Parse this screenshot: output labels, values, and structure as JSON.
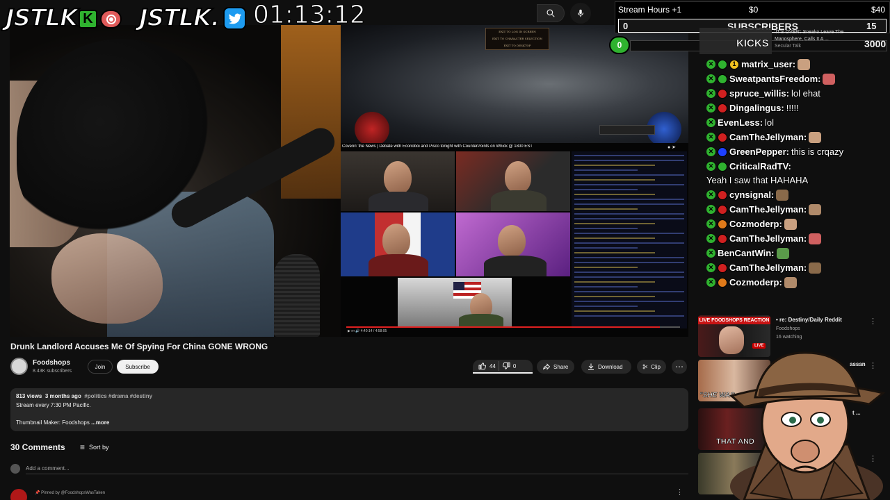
{
  "overlay": {
    "brand_1": "JSTLK",
    "brand_2": "JSTLK.",
    "kick_letter": "K",
    "timer": "01:13:12",
    "goals": {
      "label": "Stream Hours +1",
      "amount_start": "$0",
      "amount_end": "$40",
      "subs_current": "0",
      "subs_label": "SUBSCRIBERS",
      "subs_target": "15",
      "kicks_current": "0",
      "kicks_label": "KICKS",
      "kicks_target": "3000"
    },
    "kicks_news": {
      "title": "'IT'S OVER': Sneako Leave The Manosphere, Calls It A ...",
      "channel": "Secular Talk"
    }
  },
  "player": {
    "game_menu": [
      "EXIT TO LOG IN SCREEN",
      "EXIT TO CHARACTER SELECTION",
      "EXIT TO DESKTOP"
    ],
    "debate_title": "Coverin' the News | Debate with Econoboi and Pisco tonight with CounterPoints on Whick @ 1800 EST",
    "time": "4:40:14 / 4:58:05",
    "progress": 0.94
  },
  "video": {
    "title": "Drunk Landlord Accuses Me Of Spying For China GONE WRONG",
    "channel": "Foodshops",
    "subscribers": "8.43K subscribers",
    "join": "Join",
    "subscribe": "Subscribe",
    "likes": "44",
    "dislikes": "0",
    "share": "Share",
    "download": "Download",
    "clip": "Clip"
  },
  "description": {
    "views": "813 views",
    "date": "3 months ago",
    "tags": "#politics #drama #destiny",
    "line1": "Stream every 7:30 PM Pacific.",
    "line2": "Thumbnail Maker: Foodshops",
    "more": "...more"
  },
  "comments": {
    "title": "30 Comments",
    "sort": "Sort by",
    "placeholder": "Add a comment...",
    "pinned": "Pinned by @FoodshopsWasTaken"
  },
  "chat": [
    {
      "user": "matrix_user:",
      "text": "",
      "dot": "#2fb22f",
      "badge": "1"
    },
    {
      "user": "SweatpantsFreedom:",
      "text": "",
      "dot": "#2fb22f"
    },
    {
      "user": "spruce_willis:",
      "text": "lol ehat",
      "dot": "#d02020"
    },
    {
      "user": "Dingalingus:",
      "text": "!!!!!",
      "dot": "#d02020"
    },
    {
      "user": "EvenLess:",
      "text": "lol"
    },
    {
      "user": "CamTheJellyman:",
      "text": "",
      "dot": "#d02020"
    },
    {
      "user": "GreenPepper:",
      "text": "this is crqazy",
      "dot": "#1e40ff"
    },
    {
      "user": "CriticalRadTV:",
      "text": "Yeah I saw that HAHAHA",
      "dot": "#2fb22f"
    },
    {
      "user": "cynsignal:",
      "text": "",
      "dot": "#d02020"
    },
    {
      "user": "CamTheJellyman:",
      "text": "",
      "dot": "#d02020"
    },
    {
      "user": "Cozmoderp:",
      "text": "",
      "dot": "#e07a1a"
    },
    {
      "user": "CamTheJellyman:",
      "text": "",
      "dot": "#d02020"
    },
    {
      "user": "BenCantWin:",
      "text": ""
    },
    {
      "user": "CamTheJellyman:",
      "text": "",
      "dot": "#d02020"
    },
    {
      "user": "Cozmoderp:",
      "text": "",
      "dot": "#e07a1a"
    }
  ],
  "recommendations": [
    {
      "thumb_text": "LIVE FOODSHOPS REACTION",
      "title": "re: Destiny/Daily Reddit",
      "channel": "Foodshops",
      "meta": "16 watching",
      "live": "LIVE"
    },
    {
      "thumb_text": "\"SHE WAS",
      "title": "",
      "channel": "",
      "meta": "",
      "title_tail": "assan"
    },
    {
      "thumb_text": "THAT AND",
      "title": "",
      "channel": "",
      "meta": "",
      "title_tail": "t ..."
    },
    {
      "thumb_text": "",
      "title": "",
      "channel": "",
      "meta": ""
    }
  ]
}
